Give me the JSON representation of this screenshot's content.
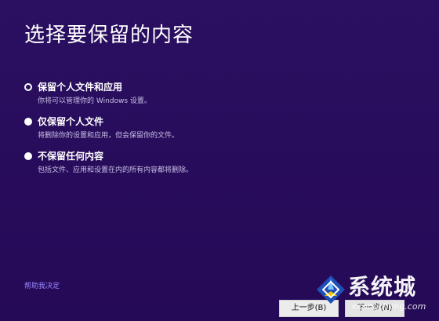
{
  "page": {
    "title": "选择要保留的内容"
  },
  "options": [
    {
      "label": "保留个人文件和应用",
      "description": "你将可以管理你的 Windows 设置。",
      "selected": true
    },
    {
      "label": "仅保留个人文件",
      "description": "将删除你的设置和应用，但会保留你的文件。",
      "selected": false
    },
    {
      "label": "不保留任何内容",
      "description": "包括文件、应用和设置在内的所有内容都将删除。",
      "selected": false
    }
  ],
  "footer": {
    "help_link": "帮助我决定",
    "back_label": "上一步(B)",
    "next_label": "下一步(N)"
  },
  "watermark": {
    "brand": "系统城",
    "site": "xitongcheng.com"
  },
  "colors": {
    "background": "#2a0d5e",
    "link": "#9a88ff"
  }
}
